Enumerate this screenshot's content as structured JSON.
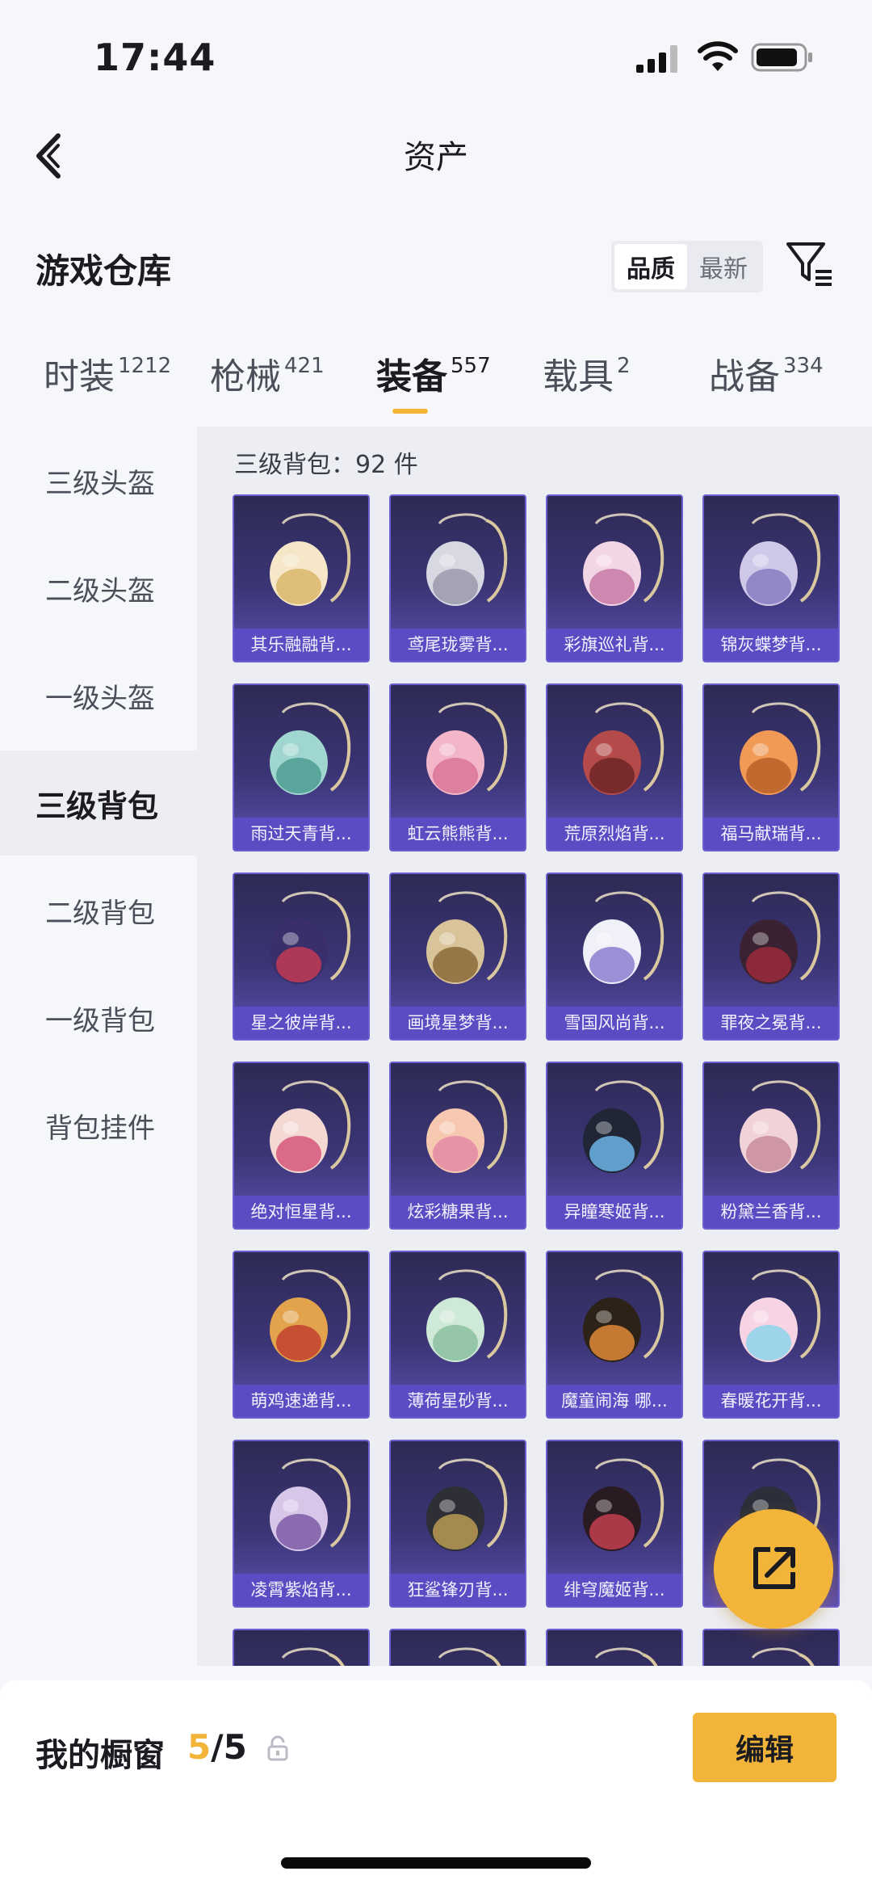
{
  "status_bar": {
    "time": "17:44"
  },
  "nav": {
    "title": "资产"
  },
  "section": {
    "title": "游戏仓库"
  },
  "sort": {
    "options": [
      "品质",
      "最新"
    ],
    "selected": "品质"
  },
  "tabs": [
    {
      "label": "时装",
      "count": "1212"
    },
    {
      "label": "枪械",
      "count": "421"
    },
    {
      "label": "装备",
      "count": "557",
      "active": true
    },
    {
      "label": "载具",
      "count": "2"
    },
    {
      "label": "战备",
      "count": "334"
    }
  ],
  "sidebar": {
    "items": [
      {
        "label": "三级头盔"
      },
      {
        "label": "二级头盔"
      },
      {
        "label": "一级头盔"
      },
      {
        "label": "三级背包",
        "active": true
      },
      {
        "label": "二级背包"
      },
      {
        "label": "一级背包"
      },
      {
        "label": "背包挂件"
      }
    ]
  },
  "content": {
    "heading": "三级背包：92 件",
    "items": [
      {
        "name": "其乐融融背...",
        "icon": "chick-backpack-icon"
      },
      {
        "name": "鸢尾珑雾背...",
        "icon": "silver-backpack-icon"
      },
      {
        "name": "彩旗巡礼背...",
        "icon": "pink-bow-backpack-icon"
      },
      {
        "name": "锦灰蝶梦背...",
        "icon": "butterfly-backpack-icon"
      },
      {
        "name": "雨过天青背...",
        "icon": "teal-backpack-icon"
      },
      {
        "name": "虹云熊熊背...",
        "icon": "pink-bear-backpack-icon"
      },
      {
        "name": "荒原烈焰背...",
        "icon": "red-armor-backpack-icon"
      },
      {
        "name": "福马献瑞背...",
        "icon": "orange-horse-backpack-icon"
      },
      {
        "name": "星之彼岸背...",
        "icon": "space-helmet-backpack-icon"
      },
      {
        "name": "画境星梦背...",
        "icon": "frame-backpack-icon"
      },
      {
        "name": "雪国风尚背...",
        "icon": "penguin-backpack-icon"
      },
      {
        "name": "罪夜之冕背...",
        "icon": "dark-crown-backpack-icon"
      },
      {
        "name": "绝对恒星背...",
        "icon": "popcorn-backpack-icon"
      },
      {
        "name": "炫彩糖果背...",
        "icon": "donut-backpack-icon"
      },
      {
        "name": "异瞳寒姬背...",
        "icon": "cat-backpack-icon"
      },
      {
        "name": "粉黛兰香背...",
        "icon": "pink-pouch-backpack-icon"
      },
      {
        "name": "萌鸡速递背...",
        "icon": "chicken-backpack-icon"
      },
      {
        "name": "薄荷星砂背...",
        "icon": "mint-pouch-backpack-icon"
      },
      {
        "name": "魔童闹海 哪...",
        "icon": "orb-backpack-icon"
      },
      {
        "name": "春暖花开背...",
        "icon": "flower-wings-backpack-icon"
      },
      {
        "name": "凌霄紫焰背...",
        "icon": "purple-flame-backpack-icon"
      },
      {
        "name": "狂鲨锋刃背...",
        "icon": "shark-backpack-icon"
      },
      {
        "name": "绯穹魔姬背...",
        "icon": "bat-backpack-icon"
      },
      {
        "name": "",
        "icon": "armor-backpack-icon"
      },
      {
        "name": "",
        "icon": "partial-backpack-icon"
      },
      {
        "name": "",
        "icon": "partial-backpack-icon"
      },
      {
        "name": "",
        "icon": "partial-backpack-icon"
      },
      {
        "name": "",
        "icon": "partial-backpack-icon"
      }
    ]
  },
  "showcase": {
    "label": "我的橱窗",
    "current": "5",
    "total": "/5",
    "edit_label": "编辑"
  },
  "colors": {
    "accent": "#f2b53a",
    "card_top": "#2e2a55",
    "card_bottom": "#5e4fb0",
    "card_label": "#5b4cc4"
  }
}
